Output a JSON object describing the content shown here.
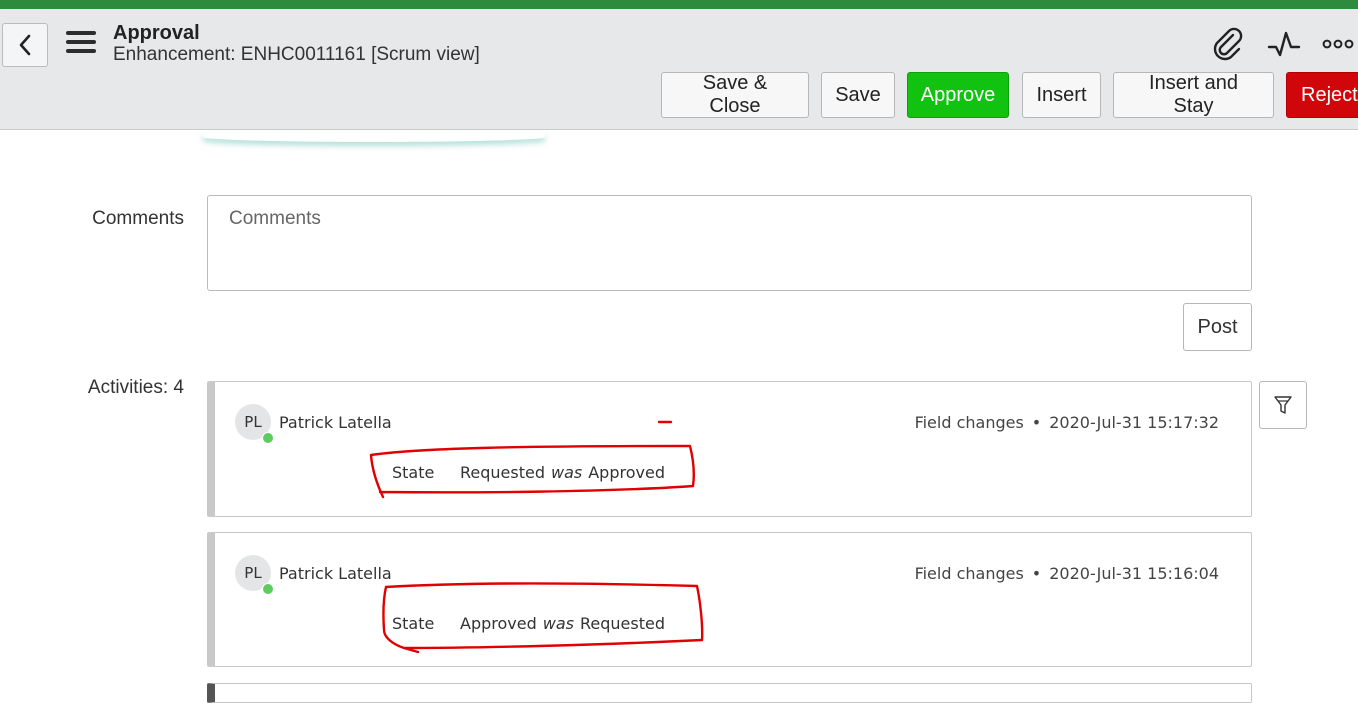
{
  "header": {
    "title": "Approval",
    "subtitle": "Enhancement: ENHC0011161 [Scrum view]",
    "icons": [
      "back-icon",
      "menu-icon",
      "paperclip-icon",
      "activity-icon",
      "more-icon"
    ]
  },
  "toolbar": {
    "save_close": "Save & Close",
    "save": "Save",
    "approve": "Approve",
    "insert": "Insert",
    "insert_stay": "Insert and Stay",
    "reject": "Reject"
  },
  "colors": {
    "accent_bar": "#2e8b3e",
    "approve": "#11c211",
    "reject": "#d0060a",
    "annotation": "#e00000"
  },
  "comments": {
    "label": "Comments",
    "placeholder": "Comments",
    "post": "Post"
  },
  "activities": {
    "label": "Activities: 4",
    "items": [
      {
        "initials": "PL",
        "author": "Patrick Latella",
        "type": "Field changes",
        "timestamp": "2020-Jul-31 15:17:32",
        "field": "State",
        "new_value": "Requested",
        "was": "was",
        "old_value": "Approved"
      },
      {
        "initials": "PL",
        "author": "Patrick Latella",
        "type": "Field changes",
        "timestamp": "2020-Jul-31 15:16:04",
        "field": "State",
        "new_value": "Approved",
        "was": "was",
        "old_value": "Requested"
      }
    ]
  }
}
